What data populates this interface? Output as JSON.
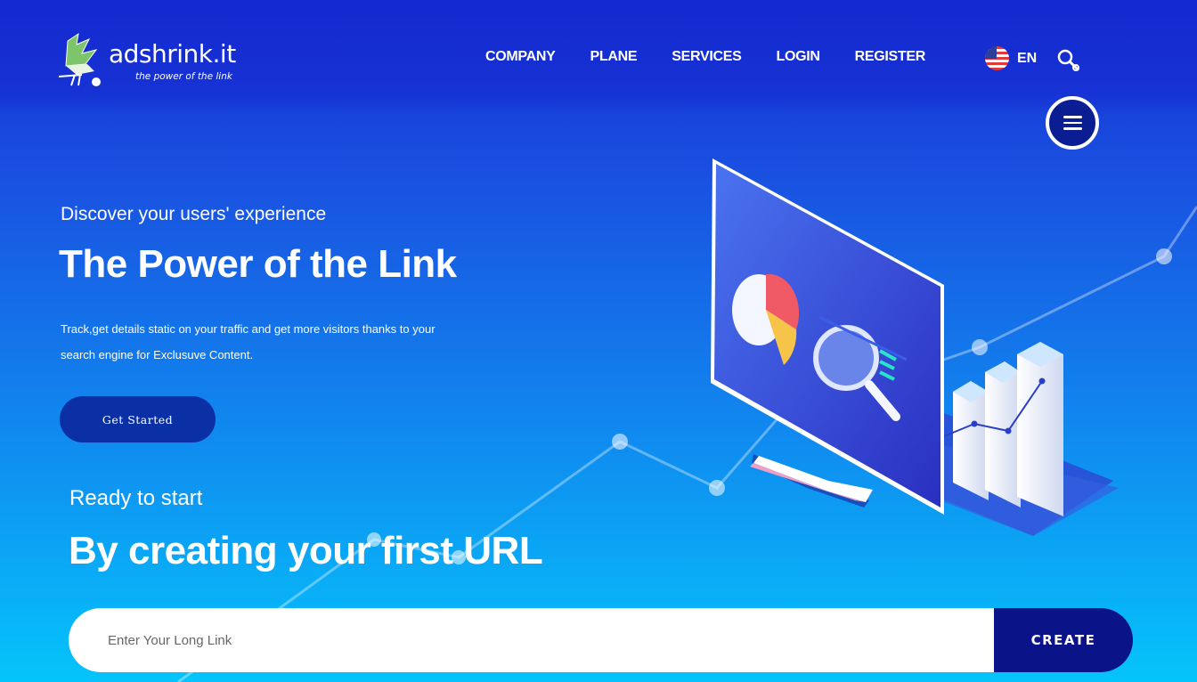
{
  "brand": {
    "name": "adshrink.it",
    "tagline": "the power of the link"
  },
  "nav": {
    "items": [
      "COMPANY",
      "PLANE",
      "SERVICES",
      "LOGIN",
      "REGISTER"
    ]
  },
  "language": {
    "label": "EN",
    "flag_icon": "us-flag-icon"
  },
  "icons": {
    "search": "search-icon",
    "menu": "hamburger-menu-icon"
  },
  "hero": {
    "subtitle": "Discover your users' experience",
    "title": "The Power of the Link",
    "description": "Track,get details static on your traffic and get more visitors thanks to your search engine for Exclusuve Content.",
    "cta_label": "Get Started"
  },
  "cta_section": {
    "subtitle": "Ready to start",
    "title": "By creating your first URL"
  },
  "url_form": {
    "placeholder": "Enter Your Long Link",
    "value": "",
    "button_label": "CREATE"
  },
  "colors": {
    "background_top": "#1530d2",
    "background_bottom": "#05c4fb",
    "cta_button": "#0b2fa5",
    "create_button": "#0a1488",
    "menu_button": "#0a1d92"
  }
}
